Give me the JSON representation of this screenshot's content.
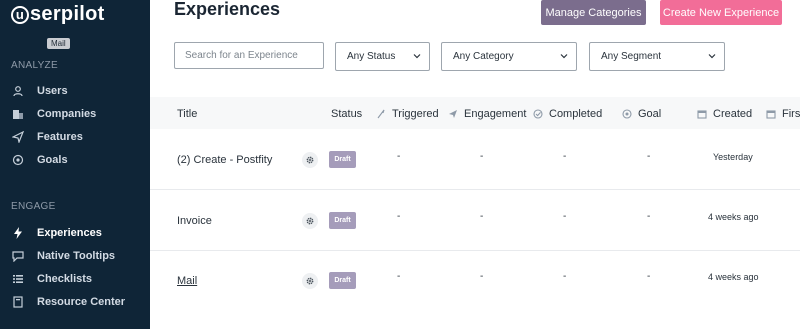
{
  "sidebar": {
    "logo_letter": "u",
    "logo_text": "serpilot",
    "tooltip": "Mail",
    "analyze_label": "ANALYZE",
    "engage_label": "ENGAGE",
    "analyze_items": [
      {
        "label": "Users",
        "icon": "user-icon"
      },
      {
        "label": "Companies",
        "icon": "building-icon"
      },
      {
        "label": "Features",
        "icon": "features-icon"
      },
      {
        "label": "Goals",
        "icon": "goal-icon"
      }
    ],
    "engage_items": [
      {
        "label": "Experiences",
        "icon": "lightning-icon",
        "active": true
      },
      {
        "label": "Native Tooltips",
        "icon": "tooltip-icon"
      },
      {
        "label": "Checklists",
        "icon": "checklist-icon"
      },
      {
        "label": "Resource Center",
        "icon": "book-icon"
      }
    ]
  },
  "header": {
    "title": "Experiences",
    "manage_label": "Manage Categories",
    "create_label": "Create New Experience"
  },
  "filters": {
    "search_placeholder": "Search for an Experience",
    "status": "Any Status",
    "category": "Any Category",
    "segment": "Any Segment"
  },
  "table": {
    "columns": [
      "Title",
      "Status",
      "Triggered",
      "Engagement",
      "Completed",
      "Goal",
      "Created",
      "First"
    ],
    "rows": [
      {
        "title": "(2) Create - Postfity",
        "status": "Draft",
        "triggered": "-",
        "engagement": "-",
        "completed": "-",
        "goal": "-",
        "created": "Yesterday"
      },
      {
        "title": "Invoice",
        "status": "Draft",
        "triggered": "-",
        "engagement": "-",
        "completed": "-",
        "goal": "-",
        "created": "4 weeks ago"
      },
      {
        "title": "Mail",
        "status": "Draft",
        "triggered": "-",
        "engagement": "-",
        "completed": "-",
        "goal": "-",
        "created": "4 weeks ago"
      }
    ]
  },
  "colors": {
    "sidebar_bg": "#0f2537",
    "manage_button": "#7b6d8d",
    "create_button": "#f26d98",
    "draft_badge": "#a59cba"
  }
}
